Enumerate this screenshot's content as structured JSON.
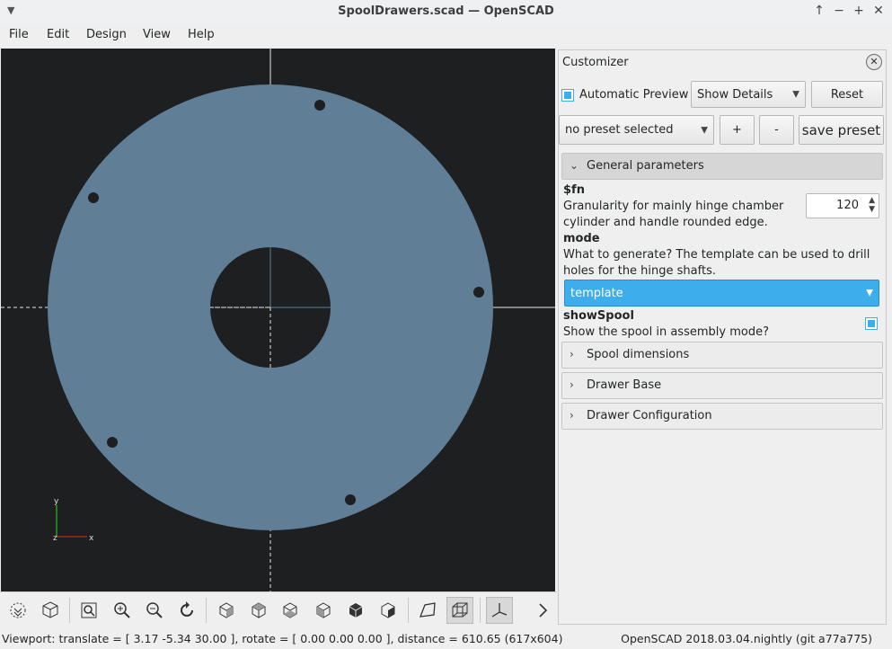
{
  "window": {
    "title": "SpoolDrawers.scad — OpenSCAD"
  },
  "menu": [
    "File",
    "Edit",
    "Design",
    "View",
    "Help"
  ],
  "viewport": {
    "axis_x": "x",
    "axis_y": "y",
    "axis_z": "z",
    "model_color": "#607e96",
    "background": "#1d1f21"
  },
  "toolbar": {
    "icons": [
      "preview-icon",
      "render-icon",
      "view-all-icon",
      "zoom-in-icon",
      "zoom-out-icon",
      "reset-view-icon",
      "view-right-icon",
      "view-top-icon",
      "view-bottom-icon",
      "view-left-icon",
      "view-front-icon",
      "view-back-icon",
      "perspective-icon",
      "orthogonal-icon",
      "show-axes-icon",
      "more-icon"
    ]
  },
  "status": {
    "viewport_info": "Viewport: translate = [ 3.17 -5.34 30.00 ], rotate = [ 0.00 0.00 0.00 ], distance = 610.65 (617x604)",
    "version": "OpenSCAD 2018.03.04.nightly (git a77a775)"
  },
  "customizer": {
    "title": "Customizer",
    "automatic_preview_label": "Automatic Preview",
    "show_details": "Show Details",
    "reset_label": "Reset",
    "preset": "no preset selected",
    "plus": "+",
    "minus": "-",
    "save_preset": "save preset",
    "general_section": "General parameters",
    "fn_name": "$fn",
    "fn_desc": "Granularity for mainly hinge chamber cylinder and handle rounded edge.",
    "fn_value": "120",
    "mode_name": "mode",
    "mode_desc": "What to generate? The template can be used to drill holes for the hinge shafts.",
    "mode_value": "template",
    "showspool_name": "showSpool",
    "showspool_desc": "Show the spool in assembly mode?",
    "sections": [
      "Spool dimensions",
      "Drawer Base",
      "Drawer Configuration"
    ]
  }
}
